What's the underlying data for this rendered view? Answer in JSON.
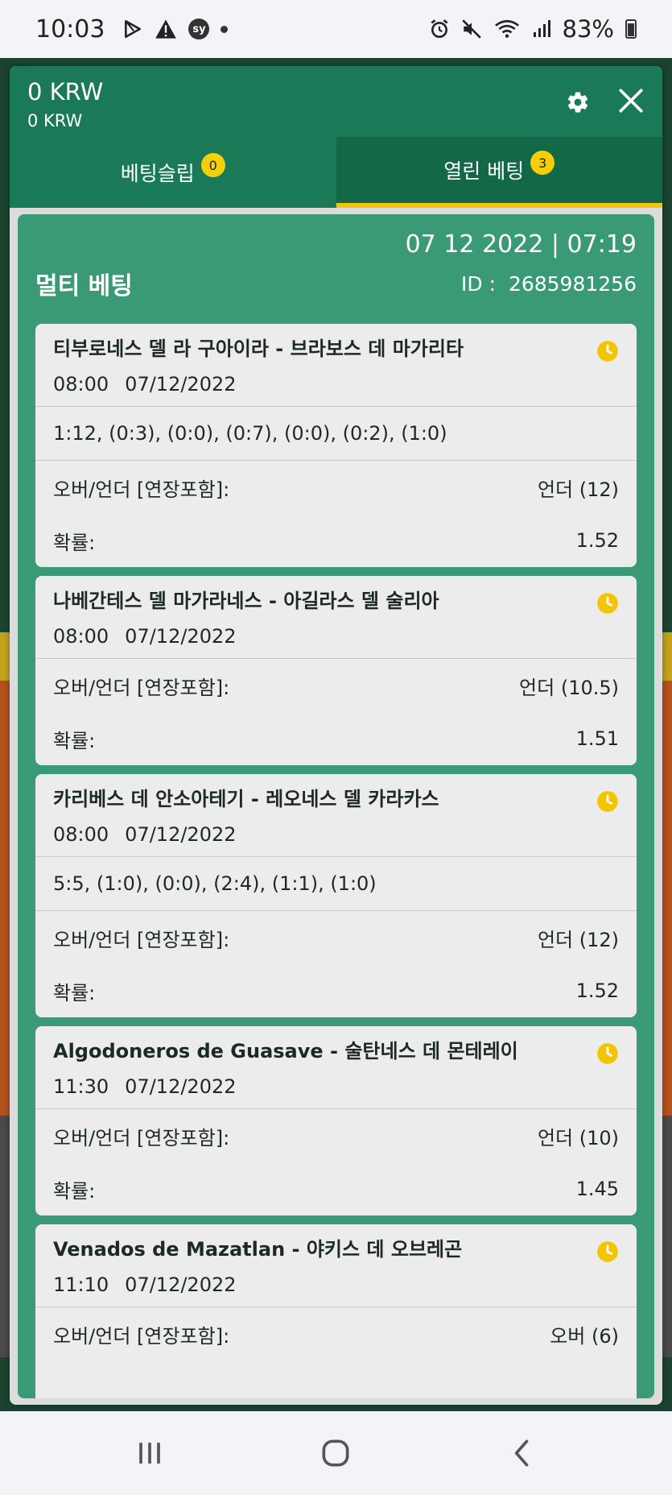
{
  "status_bar": {
    "time": "10:03",
    "sy_label": "sy",
    "battery": "83%"
  },
  "header": {
    "balance_main": "0 KRW",
    "balance_sub": "0 KRW"
  },
  "tabs": [
    {
      "label": "베팅슬립",
      "badge": "0"
    },
    {
      "label": "열린 베팅",
      "badge": "3"
    }
  ],
  "multi_bet": {
    "title": "멀티 베팅",
    "datetime": "07 12 2022 | 07:19",
    "id_label": "ID :",
    "id_value": "2685981256"
  },
  "bets": [
    {
      "title": "티부로네스 델 라 구아이라 - 브라보스 데 마가리타",
      "time": "08:00",
      "date": "07/12/2022",
      "scores": "1:12, (0:3), (0:0), (0:7), (0:0), (0:2), (1:0)",
      "market_label": "오버/언더 [연장포함]:",
      "market_value": "언더 (12)",
      "odds_label": "확률:",
      "odds_value": "1.52"
    },
    {
      "title": "나베간테스 델 마가라네스 - 아길라스 델 술리아",
      "time": "08:00",
      "date": "07/12/2022",
      "scores": "",
      "market_label": "오버/언더 [연장포함]:",
      "market_value": "언더 (10.5)",
      "odds_label": "확률:",
      "odds_value": "1.51"
    },
    {
      "title": "카리베스 데 안소아테기 - 레오네스 델 카라카스",
      "time": "08:00",
      "date": "07/12/2022",
      "scores": "5:5, (1:0), (0:0), (2:4), (1:1), (1:0)",
      "market_label": "오버/언더 [연장포함]:",
      "market_value": "언더 (12)",
      "odds_label": "확률:",
      "odds_value": "1.52"
    },
    {
      "title": "Algodoneros de Guasave - 술탄네스 데 몬테레이",
      "time": "11:30",
      "date": "07/12/2022",
      "scores": "",
      "market_label": "오버/언더 [연장포함]:",
      "market_value": "언더 (10)",
      "odds_label": "확률:",
      "odds_value": "1.45"
    },
    {
      "title": "Venados de Mazatlan - 야키스 데 오브레곤",
      "time": "11:10",
      "date": "07/12/2022",
      "scores": "",
      "market_label": "오버/언더 [연장포함]:",
      "market_value": "오버 (6)",
      "odds_label": "",
      "odds_value": ""
    }
  ],
  "colors": {
    "header_green": "#1a7a57",
    "content_green": "#3a9a75",
    "badge_yellow": "#f5cf07",
    "tab_underline": "#f1c40f"
  }
}
